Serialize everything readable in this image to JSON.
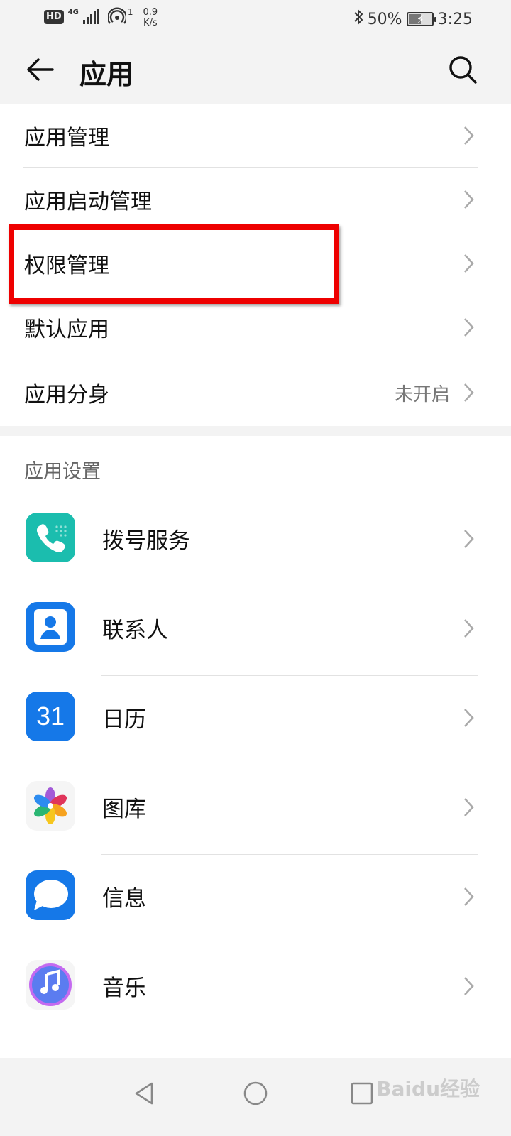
{
  "status_bar": {
    "hd": "HD",
    "network": "4G",
    "hotspot_count": "1",
    "speed_value": "0.9",
    "speed_unit": "K/s",
    "bluetooth": "bluetooth-icon",
    "battery_text": "50%",
    "battery_level": 0.5,
    "time": "3:25"
  },
  "header": {
    "back_icon": "back-arrow-icon",
    "title": "应用",
    "search_icon": "search-icon"
  },
  "menu": {
    "items": [
      {
        "label": "应用管理",
        "value": ""
      },
      {
        "label": "应用启动管理",
        "value": ""
      },
      {
        "label": "权限管理",
        "value": ""
      },
      {
        "label": "默认应用",
        "value": ""
      },
      {
        "label": "应用分身",
        "value": "未开启"
      }
    ]
  },
  "app_settings": {
    "section_title": "应用设置",
    "apps": [
      {
        "label": "拨号服务",
        "icon": "phone-icon",
        "color": "#1bbdae"
      },
      {
        "label": "联系人",
        "icon": "contacts-icon",
        "color": "#1578e8"
      },
      {
        "label": "日历",
        "icon": "calendar-icon",
        "color": "#1578e8",
        "icon_text": "31"
      },
      {
        "label": "图库",
        "icon": "gallery-icon",
        "color": "#f5f5f5"
      },
      {
        "label": "信息",
        "icon": "messages-icon",
        "color": "#1578e8"
      },
      {
        "label": "音乐",
        "icon": "music-icon",
        "color": "#5b7cf0"
      }
    ]
  },
  "highlight_color": "#ee0000",
  "nav_bar": {
    "back": "nav-back-icon",
    "home": "nav-home-icon",
    "recents": "nav-recents-icon"
  },
  "watermark": "Baidu经验"
}
